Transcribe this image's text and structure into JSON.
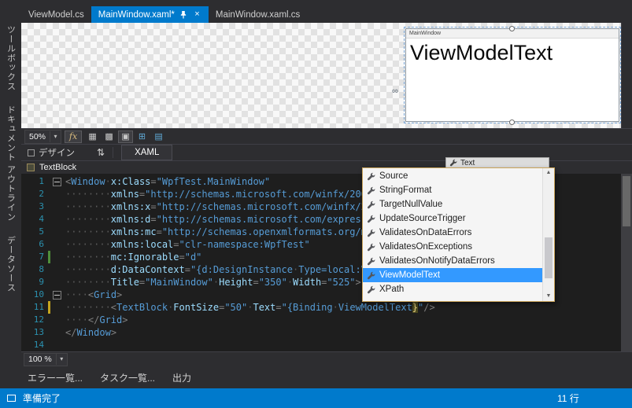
{
  "theme": {
    "accent": "#007acc",
    "selection": "#3399ff",
    "editor_bg": "#1e1e1e",
    "chrome_bg": "#2d2d30"
  },
  "icons": {
    "close": "×",
    "dropdown": "▾",
    "swap": "⇅",
    "up_arrow": "▲",
    "down_arrow": "▼",
    "anchor": "∞"
  },
  "document_tabs": [
    {
      "name": "viewmodel-cs",
      "label": "ViewModel.cs",
      "active": false
    },
    {
      "name": "mainwindow-xaml",
      "label": "MainWindow.xaml*",
      "active": true
    },
    {
      "name": "mainwindow-xaml-cs",
      "label": "MainWindow.xaml.cs",
      "active": false
    }
  ],
  "left_toolbar": {
    "items": [
      {
        "name": "toolbox",
        "label": "ツールボックス"
      },
      {
        "name": "document-outline",
        "label": "ドキュメント アウトライン"
      },
      {
        "name": "data-sources",
        "label": "データソース"
      }
    ]
  },
  "designer": {
    "preview": {
      "window_title": "MainWindow",
      "text": "ViewModelText"
    },
    "toolbar": {
      "zoom": "50%",
      "fx_label": "fx",
      "icons": [
        {
          "name": "show-snap-grid-icon",
          "glyph": "▦"
        },
        {
          "name": "snap-to-grid-icon",
          "glyph": "▩"
        },
        {
          "name": "toggle-artboard-background-icon",
          "glyph": "▣",
          "pressed": true
        },
        {
          "name": "snap-to-snaplines-icon",
          "glyph": "⊞",
          "accent": true
        },
        {
          "name": "disable-project-code-icon",
          "glyph": "▤",
          "accent": true
        }
      ]
    }
  },
  "split_bar": {
    "design_label": "デザイン",
    "xaml_label": "XAML"
  },
  "breadcrumb": {
    "label": "TextBlock"
  },
  "quickinfo_fragment": {
    "label": "Text"
  },
  "editor": {
    "zoom": "100 %",
    "lines": [
      {
        "n": 1,
        "fold": true,
        "tokens": [
          [
            "p",
            "<"
          ],
          [
            "t",
            "Window"
          ],
          [
            "w",
            "·"
          ],
          [
            "a",
            "x:Class"
          ],
          [
            "p",
            "="
          ],
          [
            "v",
            "\"WpfTest.MainWindow\""
          ]
        ]
      },
      {
        "n": 2,
        "tokens": [
          [
            "w",
            "········"
          ],
          [
            "a",
            "xmlns"
          ],
          [
            "p",
            "="
          ],
          [
            "v",
            "\"http://schemas.microsoft.com/winfx/2006/xaml/presentation\""
          ]
        ]
      },
      {
        "n": 3,
        "tokens": [
          [
            "w",
            "········"
          ],
          [
            "a",
            "xmlns:x"
          ],
          [
            "p",
            "="
          ],
          [
            "v",
            "\"http://schemas.microsoft.com/winfx/2006/xaml\""
          ]
        ]
      },
      {
        "n": 4,
        "tokens": [
          [
            "w",
            "········"
          ],
          [
            "a",
            "xmlns:d"
          ],
          [
            "p",
            "="
          ],
          [
            "v",
            "\"http://schemas.microsoft.com/expression/blend/2008\""
          ]
        ]
      },
      {
        "n": 5,
        "tokens": [
          [
            "w",
            "········"
          ],
          [
            "a",
            "xmlns:mc"
          ],
          [
            "p",
            "="
          ],
          [
            "v",
            "\"http://schemas.openxmlformats.org/markup-compatibility/2006\""
          ]
        ]
      },
      {
        "n": 6,
        "tokens": [
          [
            "w",
            "········"
          ],
          [
            "a",
            "xmlns:local"
          ],
          [
            "p",
            "="
          ],
          [
            "v",
            "\"clr-namespace:WpfTest\""
          ]
        ]
      },
      {
        "n": 7,
        "change": "green",
        "tokens": [
          [
            "w",
            "········"
          ],
          [
            "a",
            "mc:Ignorable"
          ],
          [
            "p",
            "="
          ],
          [
            "v",
            "\"d\""
          ]
        ]
      },
      {
        "n": 8,
        "tokens": [
          [
            "w",
            "········"
          ],
          [
            "a",
            "d:DataContext"
          ],
          [
            "p",
            "="
          ],
          [
            "v",
            "\"{d:DesignInstance"
          ],
          [
            "w",
            "·"
          ],
          [
            "v",
            "Type=local:ViewModel}\""
          ]
        ]
      },
      {
        "n": 9,
        "tokens": [
          [
            "w",
            "········"
          ],
          [
            "a",
            "Title"
          ],
          [
            "p",
            "="
          ],
          [
            "v",
            "\"MainWindow\""
          ],
          [
            "w",
            "·"
          ],
          [
            "a",
            "Height"
          ],
          [
            "p",
            "="
          ],
          [
            "v",
            "\"350\""
          ],
          [
            "w",
            "·"
          ],
          [
            "a",
            "Width"
          ],
          [
            "p",
            "="
          ],
          [
            "v",
            "\"525\""
          ],
          [
            "p",
            ">"
          ]
        ]
      },
      {
        "n": 10,
        "fold": true,
        "tokens": [
          [
            "w",
            "····"
          ],
          [
            "p",
            "<"
          ],
          [
            "t",
            "Grid"
          ],
          [
            "p",
            ">"
          ]
        ]
      },
      {
        "n": 11,
        "change": "yellow",
        "tokens": [
          [
            "w",
            "········"
          ],
          [
            "p",
            "<"
          ],
          [
            "t",
            "TextBlock"
          ],
          [
            "w",
            "·"
          ],
          [
            "a",
            "FontSize"
          ],
          [
            "p",
            "="
          ],
          [
            "v",
            "\"50\""
          ],
          [
            "w",
            "·"
          ],
          [
            "a",
            "Text"
          ],
          [
            "p",
            "="
          ],
          [
            "v",
            "\"{Binding"
          ],
          [
            "w",
            "·"
          ],
          [
            "v",
            "ViewModelText"
          ],
          [
            "h",
            "}"
          ],
          [
            "v",
            "\""
          ],
          [
            "p",
            "/>"
          ]
        ]
      },
      {
        "n": 12,
        "tokens": [
          [
            "w",
            "····"
          ],
          [
            "p",
            "</"
          ],
          [
            "t",
            "Grid"
          ],
          [
            "p",
            ">"
          ]
        ]
      },
      {
        "n": 13,
        "tokens": [
          [
            "p",
            "</"
          ],
          [
            "t",
            "Window"
          ],
          [
            "p",
            ">"
          ]
        ]
      },
      {
        "n": 14,
        "tokens": []
      }
    ]
  },
  "intellisense": {
    "items": [
      {
        "label": "Source"
      },
      {
        "label": "StringFormat"
      },
      {
        "label": "TargetNullValue"
      },
      {
        "label": "UpdateSourceTrigger"
      },
      {
        "label": "ValidatesOnDataErrors"
      },
      {
        "label": "ValidatesOnExceptions"
      },
      {
        "label": "ValidatesOnNotifyDataErrors"
      },
      {
        "label": "ViewModelText",
        "selected": true
      },
      {
        "label": "XPath"
      }
    ]
  },
  "bottom_panel": {
    "tabs": [
      {
        "name": "error-list",
        "label": "エラー一覧..."
      },
      {
        "name": "task-list",
        "label": "タスク一覧..."
      },
      {
        "name": "output",
        "label": "出力"
      }
    ]
  },
  "status_bar": {
    "message": "準備完了",
    "line_indicator": "11 行"
  }
}
